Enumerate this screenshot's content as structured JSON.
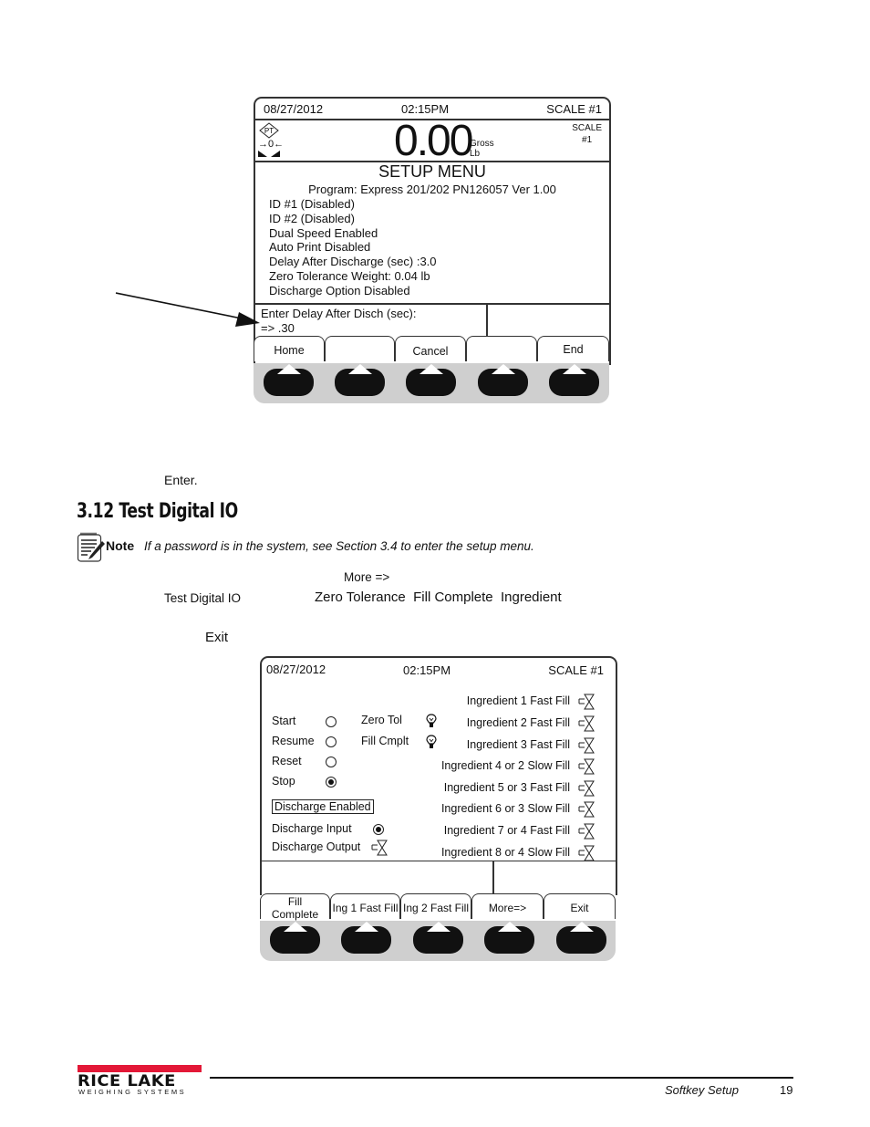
{
  "screen1": {
    "date": "08/27/2012",
    "time": "02:15PM",
    "scale": "SCALE #1",
    "weight": "0.00",
    "weight_mode": "Gross",
    "weight_unit": "Lb",
    "scale_small_line1": "SCALE",
    "scale_small_line2": "#1",
    "pt_badge": "PT",
    "zero_indicator": "→0←",
    "title": "SETUP MENU",
    "program": "Program: Express 201/202 PN126057 Ver 1.00",
    "menu_lines": [
      "ID #1 (Disabled)",
      "ID #2 (Disabled)",
      "Dual Speed Enabled",
      "Auto Print Disabled",
      "Delay After Discharge (sec) :3.0",
      "Zero Tolerance Weight: 0.04 lb",
      "Discharge Option Disabled"
    ],
    "prompt_label": "Enter Delay After Disch (sec):",
    "prompt_value": "=> .30",
    "softkeys": [
      "Home",
      "",
      "Cancel",
      "",
      "End"
    ]
  },
  "text": {
    "enter": "Enter.",
    "section_heading": "3.12   Test Digital IO",
    "note_label": "Note",
    "note_text": "If a password is in the system, see Section 3.4 to enter the setup menu.",
    "more": "More =>",
    "test_digital_io": "Test Digital IO",
    "options": "Zero Tolerance  Fill Complete  Ingredient",
    "exit": "Exit"
  },
  "screen2": {
    "date": "08/27/2012",
    "time": "02:15PM",
    "scale": "SCALE #1",
    "inputs": [
      {
        "label": "Start",
        "state": "off"
      },
      {
        "label": "Resume",
        "state": "off"
      },
      {
        "label": "Reset",
        "state": "off"
      },
      {
        "label": "Stop",
        "state": "on"
      }
    ],
    "indicators": [
      {
        "label": "Zero Tol"
      },
      {
        "label": "Fill Cmplt"
      }
    ],
    "discharge_enabled": "Discharge Enabled",
    "discharge_input": {
      "label": "Discharge Input",
      "state": "on"
    },
    "discharge_output": {
      "label": "Discharge Output"
    },
    "outputs": [
      "Ingredient 1 Fast Fill",
      "Ingredient 2 Fast Fill",
      "Ingredient 3 Fast Fill",
      "Ingredient 4 or 2 Slow Fill",
      "Ingredient 5 or 3 Fast Fill",
      "Ingredient 6 or 3 Slow Fill",
      "Ingredient 7 or 4 Fast Fill",
      "Ingredient 8 or 4 Slow Fill"
    ],
    "softkeys": [
      "Fill Complete",
      "Ing 1 Fast Fill",
      "Ing 2 Fast Fill",
      "More=>",
      "Exit"
    ],
    "softkey_fill_line1": "Fill",
    "softkey_fill_line2": "Complete"
  },
  "footer": {
    "logo_main": "RICE LAKE",
    "logo_sub": "WEIGHING SYSTEMS",
    "section": "Softkey Setup",
    "page": "19",
    "brand_color": "#e31837"
  }
}
